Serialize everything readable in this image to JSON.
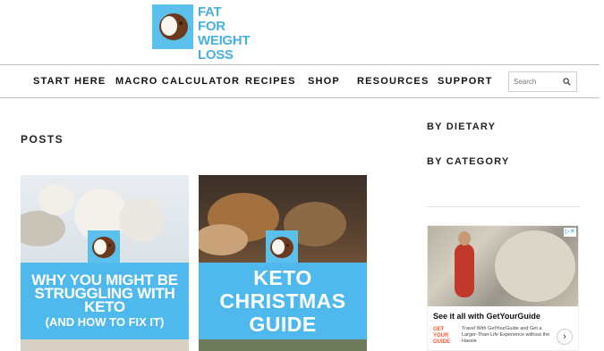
{
  "logo": {
    "line1": "FAT FOR",
    "line2": "WEIGHT",
    "line3": "LOSS"
  },
  "nav": {
    "items": [
      "START HERE",
      "MACRO CALCULATOR",
      "RECIPES",
      "SHOP",
      "RESOURCES",
      "SUPPORT"
    ],
    "search_placeholder": "Search"
  },
  "main": {
    "heading": "POSTS",
    "cards": [
      {
        "title": "WHY YOU MIGHT BE STRUGGLING WITH KETO",
        "subtitle": "(AND HOW TO FIX IT)"
      },
      {
        "title_line1": "KETO",
        "title_line2": "CHRISTMAS",
        "title_line3": "GUIDE"
      }
    ]
  },
  "sidebar": {
    "heading_dietary": "BY DIETARY",
    "heading_category": "BY CATEGORY"
  },
  "ad": {
    "headline": "See it all with GetYourGuide",
    "brand": "GET YOUR GUIDE",
    "body": "Travel With GetYourGuide and Get a Larger-Than-Life Experience without the Hassle",
    "adchoices": "▷✕",
    "next": "›"
  },
  "colors": {
    "brand_blue": "#5bc0eb",
    "banner_blue": "#4fb9ee",
    "coconut_brown": "#6b3a1e"
  }
}
